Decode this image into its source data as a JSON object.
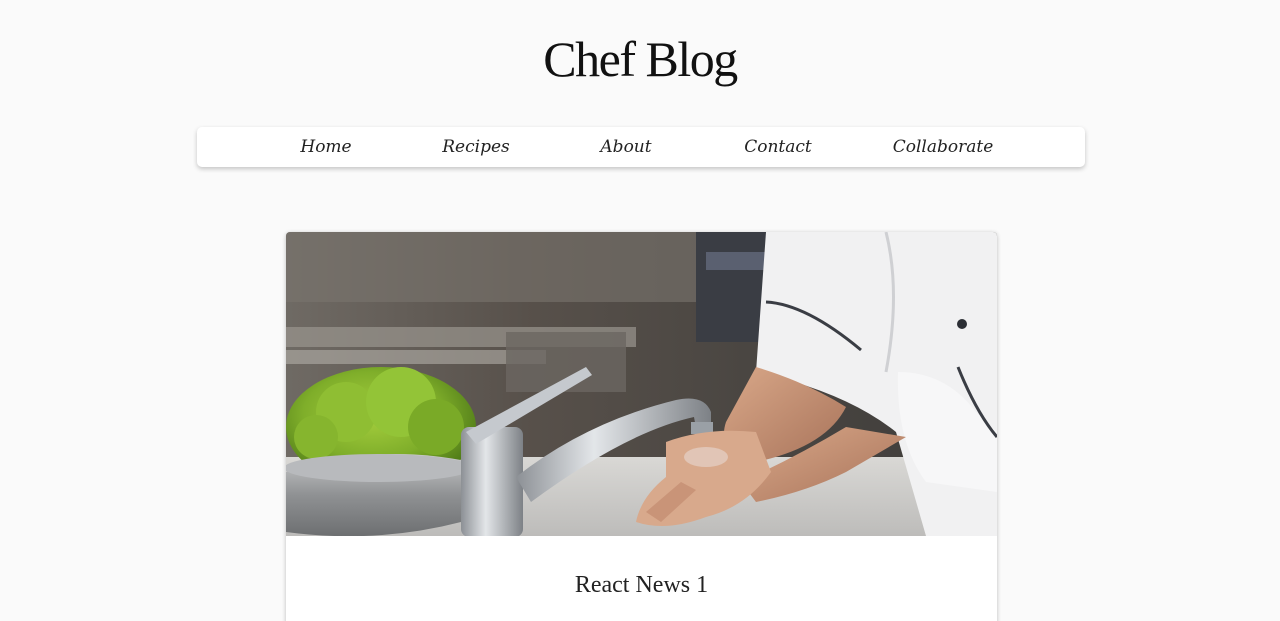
{
  "header": {
    "site_title": "Chef Blog"
  },
  "nav": {
    "items": [
      {
        "label": "Home"
      },
      {
        "label": "Recipes"
      },
      {
        "label": "About"
      },
      {
        "label": "Contact"
      },
      {
        "label": "Collaborate"
      }
    ]
  },
  "post": {
    "title": "React News 1"
  }
}
